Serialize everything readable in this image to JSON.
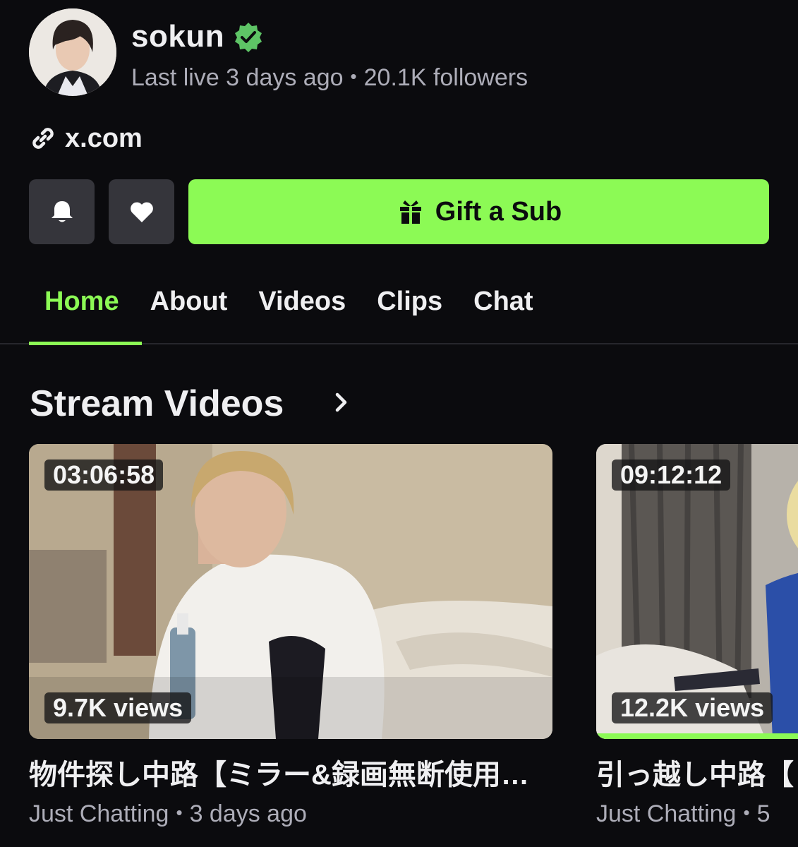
{
  "channel": {
    "name": "sokun",
    "last_live": "Last live 3 days ago",
    "separator": "•",
    "followers": "20.1K followers",
    "link": "x.com"
  },
  "actions": {
    "bell_icon": "bell-icon",
    "heart_icon": "heart-icon",
    "gift_label": "Gift a Sub"
  },
  "tabs": [
    {
      "label": "Home",
      "active": true
    },
    {
      "label": "About",
      "active": false
    },
    {
      "label": "Videos",
      "active": false
    },
    {
      "label": "Clips",
      "active": false
    },
    {
      "label": "Chat",
      "active": false
    }
  ],
  "section": {
    "title": "Stream Videos"
  },
  "videos": [
    {
      "duration": "03:06:58",
      "views": "9.7K views",
      "title": "物件探し中路【ミラー&録画無断使用…",
      "category": "Just Chatting",
      "separator": "•",
      "age": "3 days ago",
      "watch_progress": 0
    },
    {
      "duration": "09:12:12",
      "views": "12.2K views",
      "title": "引っ越し中路【",
      "category": "Just Chatting",
      "separator": "•",
      "age": "5",
      "watch_progress": 1.0
    }
  ],
  "colors": {
    "accent": "#8cfa55",
    "background": "#0b0b0e",
    "muted_text": "#adadb8",
    "button_bg": "#35353b"
  }
}
